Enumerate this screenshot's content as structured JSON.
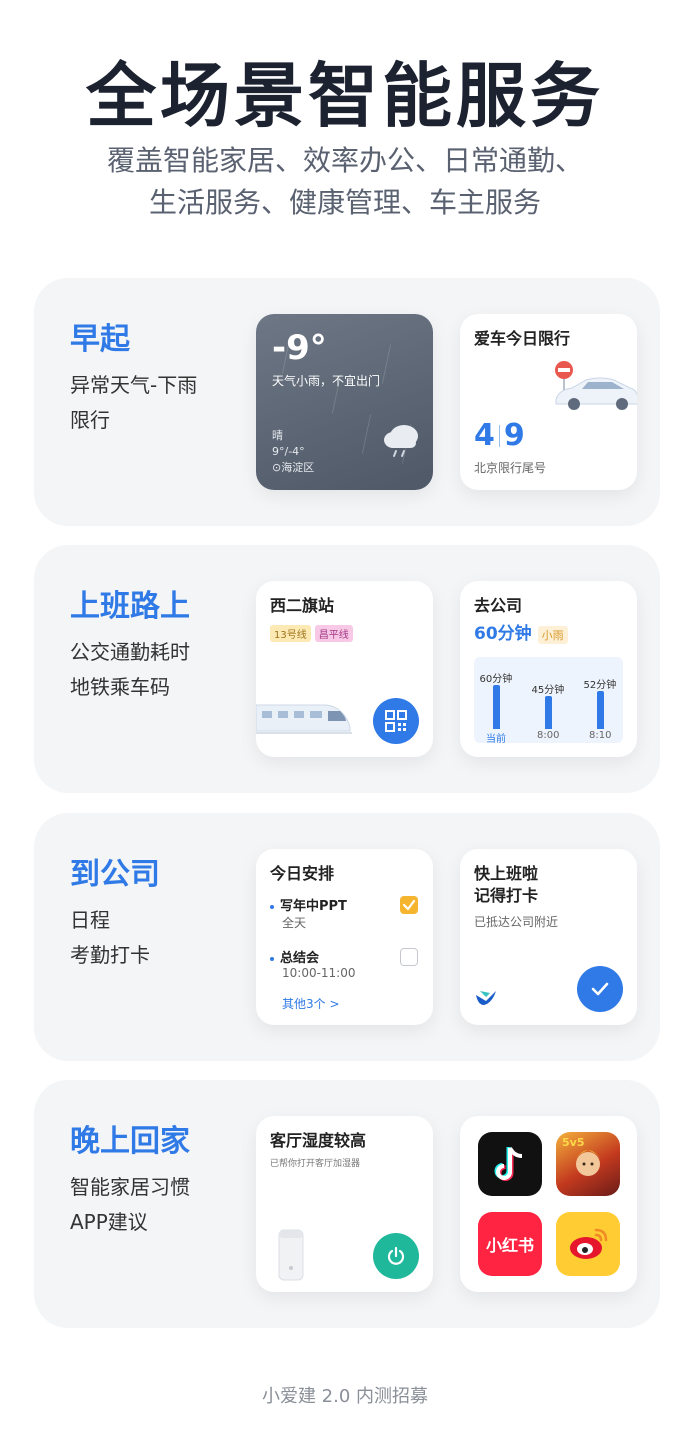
{
  "header": {
    "title": "全场景智能服务",
    "subtitle_line1": "覆盖智能家居、效率办公、日常通勤、",
    "subtitle_line2": "生活服务、健康管理、车主服务"
  },
  "sections": [
    {
      "title": "早起",
      "desc1": "异常天气-下雨",
      "desc2": "限行",
      "weather": {
        "temp": "-9°",
        "desc": "天气小雨，不宜出门",
        "condition": "晴",
        "range": "9°/-4°",
        "location": "海淀区"
      },
      "car": {
        "title": "爱车今日限行",
        "plate_a": "4",
        "plate_b": "9",
        "caption": "北京限行尾号"
      }
    },
    {
      "title": "上班路上",
      "desc1": "公交通勤耗时",
      "desc2": "地铁乘车码",
      "metro": {
        "station": "西二旗站",
        "line1": "13号线",
        "line2": "昌平线"
      },
      "commute": {
        "title": "去公司",
        "duration": "60分钟",
        "weather_tag": "小雨",
        "bars": [
          {
            "label": "60分钟",
            "x": "当前",
            "minutes": 60
          },
          {
            "label": "45分钟",
            "x": "8:00",
            "minutes": 45
          },
          {
            "label": "52分钟",
            "x": "8:10",
            "minutes": 52
          }
        ]
      }
    },
    {
      "title": "到公司",
      "desc1": "日程",
      "desc2": "考勤打卡",
      "schedule": {
        "title": "今日安排",
        "task1_title": "写年中PPT",
        "task1_time": "全天",
        "task2_title": "总结会",
        "task2_time": "10:00-11:00",
        "more": "其他3个 >"
      },
      "clockin": {
        "title_line1": "快上班啦",
        "title_line2": "记得打卡",
        "desc": "已抵达公司附近"
      }
    },
    {
      "title": "晚上回家",
      "desc1": "智能家居习惯",
      "desc2": "APP建议",
      "humidity": {
        "title": "客厅湿度较高",
        "desc": "已帮你打开客厅加湿器"
      },
      "apps": {
        "xhs_label": "小红书",
        "game_badge": "5v5"
      }
    }
  ],
  "footer": "小爱建 2.0 内测招募",
  "colors": {
    "accent": "#2f7ae6",
    "section_bg": "#f4f5f7",
    "power_green": "#1fb89a",
    "check_yellow": "#f5b52e"
  }
}
